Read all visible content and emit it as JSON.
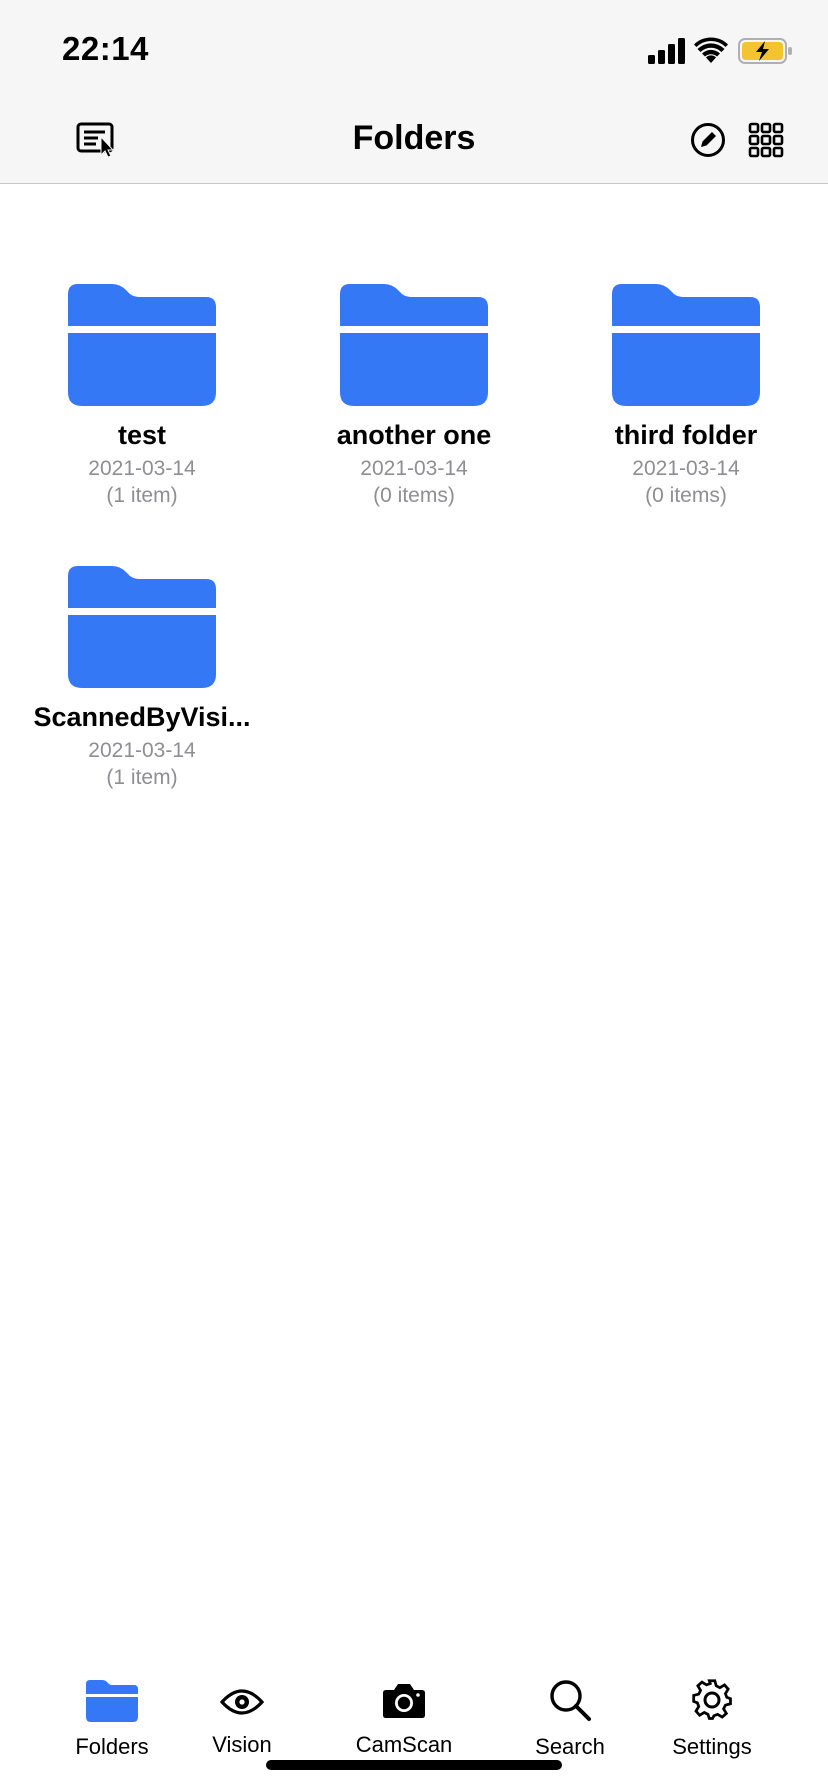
{
  "status_bar": {
    "time": "22:14"
  },
  "header": {
    "title": "Folders"
  },
  "folders": [
    {
      "name": "test",
      "date": "2021-03-14",
      "count": "(1 item)"
    },
    {
      "name": "another one",
      "date": "2021-03-14",
      "count": "(0 items)"
    },
    {
      "name": "third folder",
      "date": "2021-03-14",
      "count": "(0 items)"
    },
    {
      "name": "ScannedByVisi...",
      "date": "2021-03-14",
      "count": "(1 item)"
    }
  ],
  "tabs": [
    {
      "label": "Folders",
      "icon": "folder-icon",
      "active": true
    },
    {
      "label": "Vision",
      "icon": "eye-icon",
      "active": false
    },
    {
      "label": "CamScan",
      "icon": "camera-icon",
      "active": false
    },
    {
      "label": "Search",
      "icon": "search-icon",
      "active": false
    },
    {
      "label": "Settings",
      "icon": "gear-icon",
      "active": false
    }
  ],
  "colors": {
    "accent": "#3478f6",
    "battery": "#f4c430",
    "header_bg": "#f6f6f6",
    "secondary_text": "#8e8e93"
  }
}
